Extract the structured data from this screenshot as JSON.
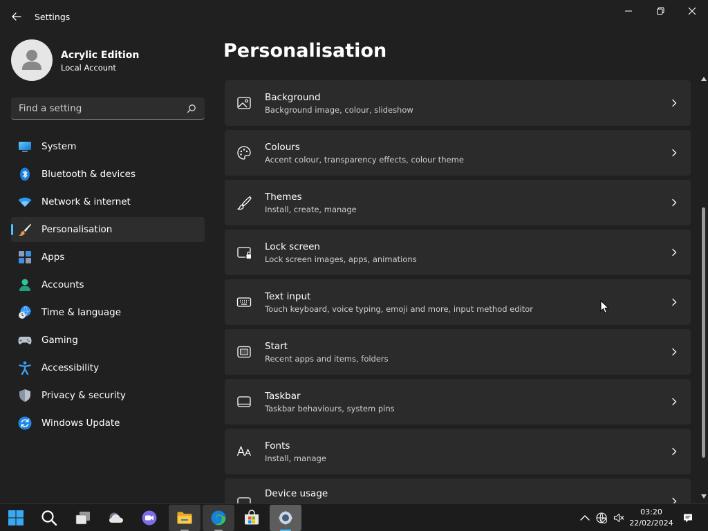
{
  "window": {
    "title": "Settings"
  },
  "profile": {
    "name": "Acrylic Edition",
    "account_type": "Local Account"
  },
  "search": {
    "placeholder": "Find a setting"
  },
  "sidebar": {
    "items": [
      {
        "label": "System",
        "icon": "system-icon"
      },
      {
        "label": "Bluetooth & devices",
        "icon": "bluetooth-icon"
      },
      {
        "label": "Network & internet",
        "icon": "wifi-icon"
      },
      {
        "label": "Personalisation",
        "icon": "brush-icon",
        "active": true
      },
      {
        "label": "Apps",
        "icon": "apps-icon"
      },
      {
        "label": "Accounts",
        "icon": "accounts-icon"
      },
      {
        "label": "Time & language",
        "icon": "globe-clock-icon"
      },
      {
        "label": "Gaming",
        "icon": "gamepad-icon"
      },
      {
        "label": "Accessibility",
        "icon": "accessibility-icon"
      },
      {
        "label": "Privacy & security",
        "icon": "shield-icon"
      },
      {
        "label": "Windows Update",
        "icon": "update-icon"
      }
    ]
  },
  "main": {
    "title": "Personalisation",
    "cards": [
      {
        "title": "Background",
        "subtitle": "Background image, colour, slideshow",
        "icon": "image-icon"
      },
      {
        "title": "Colours",
        "subtitle": "Accent colour, transparency effects, colour theme",
        "icon": "palette-icon"
      },
      {
        "title": "Themes",
        "subtitle": "Install, create, manage",
        "icon": "brush-icon"
      },
      {
        "title": "Lock screen",
        "subtitle": "Lock screen images, apps, animations",
        "icon": "lock-screen-icon"
      },
      {
        "title": "Text input",
        "subtitle": "Touch keyboard, voice typing, emoji and more, input method editor",
        "icon": "keyboard-icon"
      },
      {
        "title": "Start",
        "subtitle": "Recent apps and items, folders",
        "icon": "start-icon"
      },
      {
        "title": "Taskbar",
        "subtitle": "Taskbar behaviours, system pins",
        "icon": "taskbar-icon"
      },
      {
        "title": "Fonts",
        "subtitle": "Install, manage",
        "icon": "fonts-icon"
      },
      {
        "title": "Device usage",
        "subtitle": "",
        "icon": "device-usage-icon"
      }
    ]
  },
  "taskbar": {
    "apps": [
      {
        "name": "start-icon"
      },
      {
        "name": "search-icon"
      },
      {
        "name": "task-view-icon"
      },
      {
        "name": "widgets-icon"
      },
      {
        "name": "chat-icon"
      },
      {
        "name": "file-explorer-icon",
        "state": "open"
      },
      {
        "name": "edge-icon",
        "state": "open"
      },
      {
        "name": "store-icon"
      },
      {
        "name": "settings-icon",
        "state": "selected"
      }
    ],
    "clock": {
      "time": "03:20",
      "date": "22/02/2024"
    }
  },
  "colors": {
    "accent": "#4cc2ff",
    "window_bg": "#202020",
    "card_bg": "#2b2b2b"
  }
}
